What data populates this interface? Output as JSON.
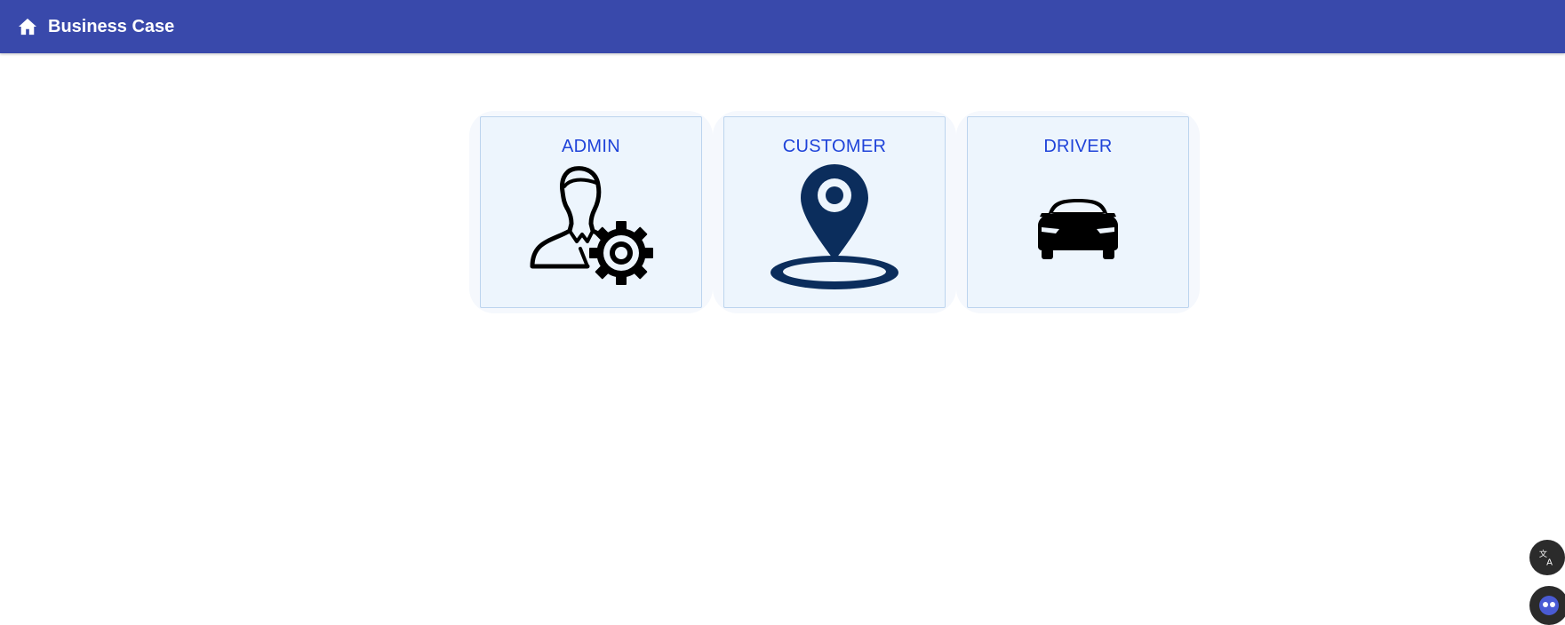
{
  "appbar": {
    "title": "Business Case",
    "home_icon": "home-icon",
    "background": "#3949ab"
  },
  "cards": [
    {
      "label": "ADMIN",
      "icon": "admin-settings-icon"
    },
    {
      "label": "CUSTOMER",
      "icon": "location-pin-icon"
    },
    {
      "label": "DRIVER",
      "icon": "car-icon"
    }
  ],
  "floating_buttons": [
    {
      "icon": "translate-icon"
    },
    {
      "icon": "assistant-icon"
    }
  ],
  "colors": {
    "accent": "#1f43d9",
    "card_bg": "#edf5fd",
    "pin": "#0b2d5c"
  }
}
